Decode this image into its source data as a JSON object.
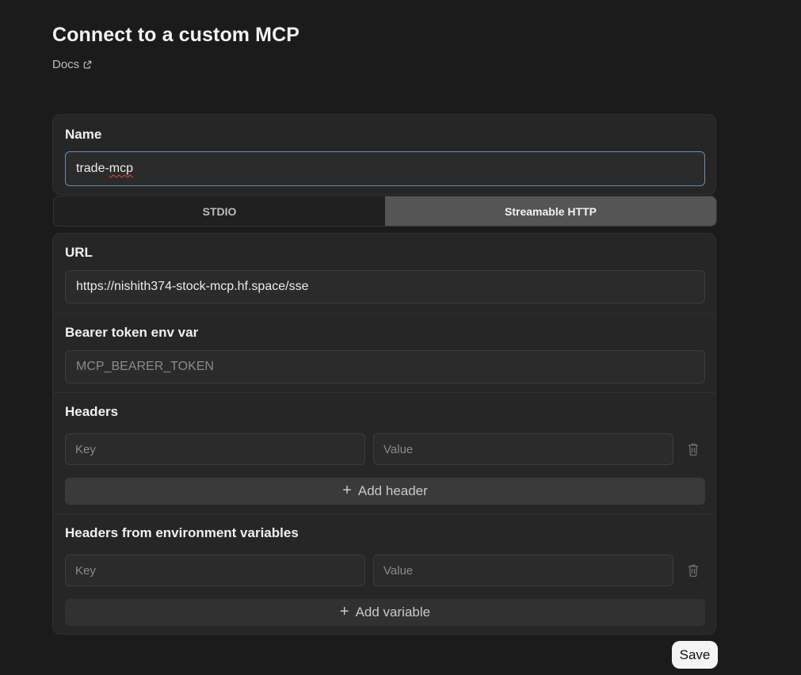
{
  "page": {
    "title": "Connect to a custom MCP",
    "docs_label": "Docs"
  },
  "name_section": {
    "label": "Name",
    "value": "trade-mcp",
    "value_prefix": "trade-",
    "value_misspelled": "mcp"
  },
  "transport_toggle": {
    "options": [
      "STDIO",
      "Streamable HTTP"
    ],
    "selected": "Streamable HTTP"
  },
  "url_section": {
    "label": "URL",
    "value": "https://nishith374-stock-mcp.hf.space/sse"
  },
  "bearer_section": {
    "label": "Bearer token env var",
    "placeholder": "MCP_BEARER_TOKEN"
  },
  "headers_section": {
    "label": "Headers",
    "key_placeholder": "Key",
    "value_placeholder": "Value",
    "add_label": "Add header"
  },
  "env_headers_section": {
    "label": "Headers from environment variables",
    "key_placeholder": "Key",
    "value_placeholder": "Value",
    "add_label": "Add variable"
  },
  "actions": {
    "save_label": "Save",
    "plus_glyph": "+"
  },
  "icons": {
    "docs": "external-link-icon",
    "delete": "trash-icon",
    "add": "plus-icon"
  },
  "colors": {
    "background": "#1b1b1b",
    "card": "#262626",
    "toggle_active": "#555555",
    "focus_border": "#6a8fb0",
    "save_button": "#f4f4f4"
  }
}
